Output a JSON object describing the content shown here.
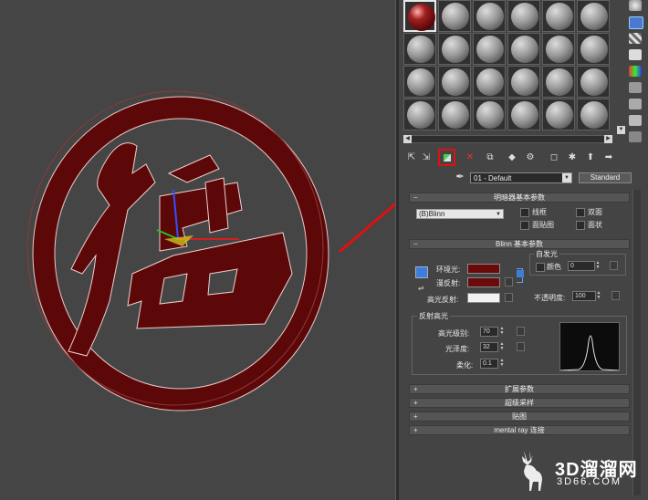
{
  "editor": {
    "material_name": "01 - Default",
    "material_type": "Standard"
  },
  "shader_basic_params": {
    "title": "明暗器基本参数",
    "shader": "(B)Blinn",
    "options": [
      "线框",
      "双面",
      "面贴图",
      "面状"
    ]
  },
  "blinn_basic_params": {
    "title": "Blinn 基本参数",
    "self_illum_title": "自发光",
    "self_illum_color_label": "颜色",
    "self_illum_value": "0",
    "ambient_label": "环境光:",
    "diffuse_label": "漫反射:",
    "specular_label": "高光反射:",
    "opacity_label": "不透明度:",
    "opacity_value": "100",
    "colors": {
      "ambient": "#6b0a0a",
      "diffuse": "#6b0a0a",
      "specular": "#f2f2f2"
    }
  },
  "specular_highlights": {
    "title": "反射高光",
    "level_label": "高光级别:",
    "level_value": "70",
    "gloss_label": "光泽度:",
    "gloss_value": "32",
    "soften_label": "柔化:",
    "soften_value": "0.1"
  },
  "collapsed_rollouts": [
    "扩展参数",
    "超级采样",
    "贴图",
    "mental ray 连接"
  ],
  "watermark": {
    "brand": "3D溜溜网",
    "url": "3D66.COM"
  }
}
